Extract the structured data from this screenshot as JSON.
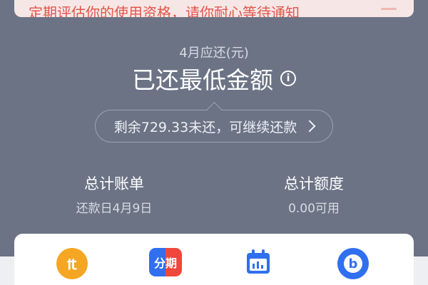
{
  "banner": {
    "text": "定期评估你的使用资格，请你耐心等待通知"
  },
  "bill": {
    "period_label": "4月应还(元)",
    "status": "已还最低金额",
    "remaining_notice": "剩余729.33未还，可继续还款"
  },
  "summary": {
    "total_bill_label": "总计账单",
    "repayment_day": "还款日4月9日",
    "total_credit_label": "总计额度",
    "available_credit": "0.00可用"
  },
  "quick_actions": [
    {
      "icon": "coin-icon",
      "glyph": "₶"
    },
    {
      "icon": "installment-icon",
      "glyph": "分期"
    },
    {
      "icon": "calendar-icon",
      "glyph": ""
    },
    {
      "icon": "b-logo-icon",
      "glyph": "b"
    }
  ],
  "colors": {
    "background": "#6b7385",
    "banner_bg": "#f6e7e6",
    "banner_text": "#e0564a",
    "accent_blue": "#2f6ff0",
    "accent_orange": "#f5a623",
    "accent_red": "#f0473c"
  }
}
